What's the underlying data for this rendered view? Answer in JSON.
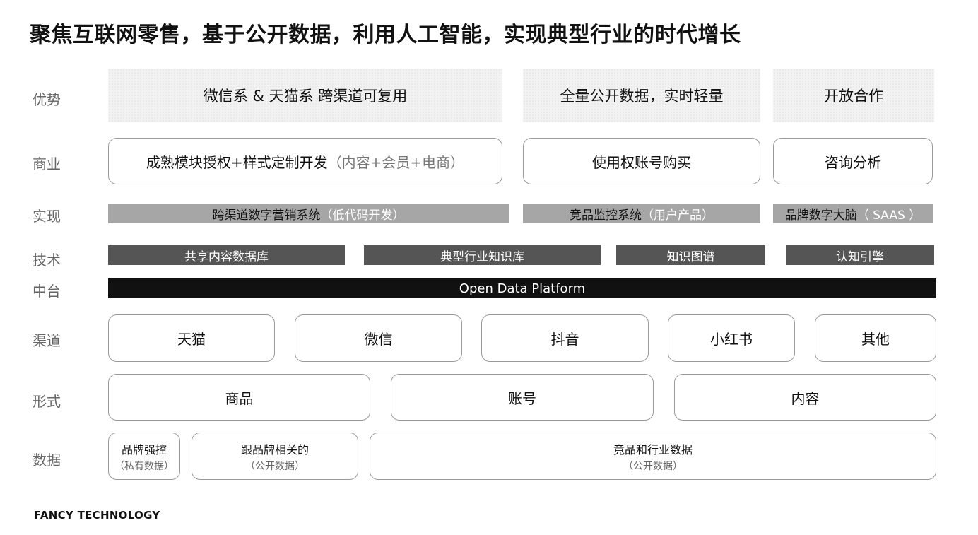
{
  "title": "聚焦互联网零售，基于公开数据，利用人工智能，实现典型行业的时代增长",
  "labels": {
    "advantage": "优势",
    "business": "商业",
    "implementation": "实现",
    "technology": "技术",
    "middle": "中台",
    "channel": "渠道",
    "form": "形式",
    "data": "数据"
  },
  "advantages": [
    "微信系 & 天猫系 跨渠道可复用",
    "全量公开数据，实时轻量",
    "开放合作"
  ],
  "business": {
    "b1_main": "成熟模块授权+样式定制开发",
    "b1_sub": "（内容+会员+电商）",
    "b2": "使用权账号购买",
    "b3": "咨询分析"
  },
  "implementation": {
    "i1_main": "跨渠道数字营销系统",
    "i1_sub": "（低代码开发）",
    "i2_main": "竞品监控系统",
    "i2_sub": "（用户产品）",
    "i3_main": "品牌数字大脑",
    "i3_sub": "（ SAAS ）"
  },
  "technology": [
    "共享内容数据库",
    "典型行业知识库",
    "知识图谱",
    "认知引擎"
  ],
  "platform": "Open Data Platform",
  "channels": [
    "天猫",
    "微信",
    "抖音",
    "小红书",
    "其他"
  ],
  "forms": [
    "商品",
    "账号",
    "内容"
  ],
  "data_sources": [
    {
      "main": "品牌强控",
      "sub": "（私有数据）"
    },
    {
      "main": "跟品牌相关的",
      "sub": "（公开数据）"
    },
    {
      "main": "竟品和行业数据",
      "sub": "（公开数据）"
    }
  ],
  "footer": "FANCY TECHNOLOGY"
}
